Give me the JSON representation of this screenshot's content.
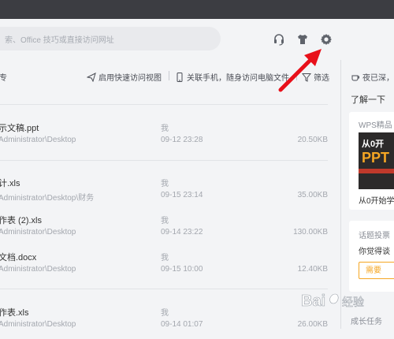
{
  "header": {
    "search_placeholder": "索、Office 技巧或直接访问网址",
    "icons": [
      "headset-icon",
      "skin-shirt-icon",
      "settings-gear-icon"
    ]
  },
  "toolbar": {
    "label_partial": "专",
    "quick_access_view": "启用快速访问视图",
    "link_phone": "关联手机，随身访问电脑文件",
    "filter": "筛选"
  },
  "files": [
    {
      "name": "示文稿.ppt",
      "path": "Administrator\\Desktop",
      "owner": "我",
      "date": "09-12 23:28",
      "size": "20.50KB"
    },
    {
      "name": "计.xls",
      "path": "Administrator\\Desktop\\财务",
      "owner": "我",
      "date": "09-15 23:14",
      "size": "35.00KB"
    },
    {
      "name": "作表 (2).xls",
      "path": "Administrator\\Desktop",
      "owner": "我",
      "date": "09-14 23:22",
      "size": "130.00KB"
    },
    {
      "name": "文档.docx",
      "path": "Administrator\\Desktop",
      "owner": "我",
      "date": "09-15 10:00",
      "size": "12.40KB"
    },
    {
      "name": "作表.xls",
      "path": "Administrator\\Desktop",
      "owner": "我",
      "date": "09-14 01:07",
      "size": "26.00KB"
    }
  ],
  "right_panel": {
    "top_text": "夜已深，",
    "learn": "了解一下",
    "card_title": "WPS精品",
    "thumb_line1": "从0开",
    "thumb_line2": "PPT",
    "card_caption": "从0开始学",
    "poll_title": "话题投票",
    "poll_question": "你觉得谈",
    "poll_option": "需要",
    "bottom_text": "成长任务"
  },
  "colors": {
    "titlebar": "#3c3d42",
    "background": "#f3f4f6",
    "accent_orange": "#f5a623",
    "arrow_red": "#e8101a"
  }
}
